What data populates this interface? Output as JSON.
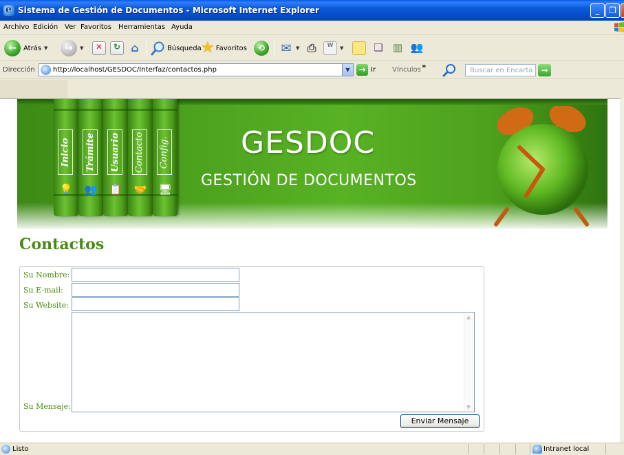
{
  "window": {
    "title": "Sistema de Gestión de Documentos - Microsoft Internet Explorer",
    "buttons": {
      "minimize": "_",
      "maximize": "❐",
      "close": "X"
    }
  },
  "menu": [
    "Archivo",
    "Edición",
    "Ver",
    "Favoritos",
    "Herramientas",
    "Ayuda"
  ],
  "toolbar": {
    "back_label": "Atrás",
    "search_label": "Búsqueda",
    "favorites_label": "Favoritos"
  },
  "address": {
    "label": "Dirección",
    "url": "http://localhost/GESDOC/Interfaz/contactos.php",
    "go_label": "Ir",
    "links_label": "Vínculos",
    "links_chevron": "»",
    "search_placeholder": "Buscar en Encarta"
  },
  "banner": {
    "tabs": [
      "Inicio",
      "Trámite",
      "Usuario",
      "Contacto",
      "Config."
    ],
    "title": "GESDOC",
    "subtitle": "GESTIÓN DE DOCUMENTOS"
  },
  "page": {
    "heading": "Contactos",
    "form": {
      "name_label": "Su Nombre:",
      "email_label": "Su E-mail:",
      "website_label": "Su Website:",
      "message_label": "Su Mensaje:",
      "name_value": "",
      "email_value": "",
      "website_value": "",
      "submit_label": "Enviar Mensaje"
    }
  },
  "status": {
    "text": "Listo",
    "zone": "Intranet local"
  },
  "colors": {
    "title_bar": "#0b5ad8",
    "heading_green": "#4a8a12",
    "banner_green": "#4da21e"
  },
  "icons": [
    "ie-logo-icon",
    "xp-flag-icon",
    "back-icon",
    "forward-icon",
    "stop-icon",
    "refresh-icon",
    "home-icon",
    "search-icon",
    "favorites-star-icon",
    "history-icon",
    "mail-icon",
    "print-icon",
    "edit-icon",
    "discuss-icon",
    "research-icon",
    "messenger-icon",
    "go-arrow-icon"
  ]
}
